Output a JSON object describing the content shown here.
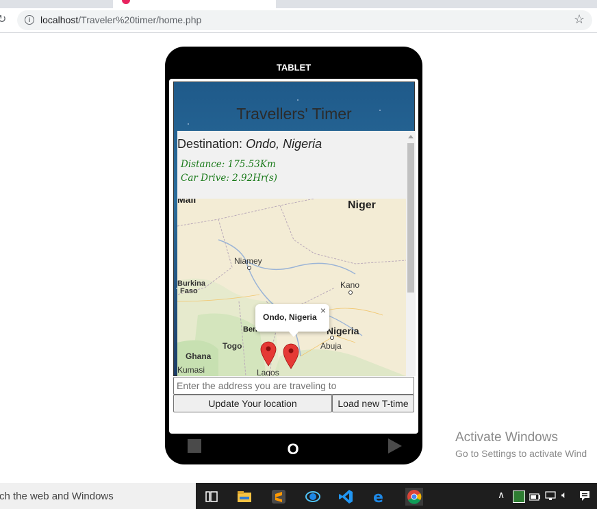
{
  "browser": {
    "url_host": "localhost",
    "url_path": "/Traveler%20timer/home.php",
    "info_icon": "info-icon",
    "star_icon": "bookmark-star-icon",
    "reload_icon": "reload-icon",
    "tab_favicon_color": "#e8235f"
  },
  "tablet": {
    "label": "TABLET",
    "app_title": "Travellers' Timer",
    "destination_prefix": "Destination: ",
    "destination_value": "Ondo, Nigeria",
    "distance_text": "Distance: 175.53Km",
    "drive_text": "Car Drive: 2.92Hr(s)",
    "address_placeholder": "Enter the address you are traveling to",
    "update_button": "Update Your location",
    "load_button": "Load new T-time",
    "nav_home": "O",
    "colors": {
      "info_text": "#1a7a1a",
      "frame": "#000000"
    }
  },
  "map": {
    "labels": {
      "mali": "Mali",
      "niger": "Niger",
      "niamey": "Niamey",
      "burkina": "Burkina",
      "faso": "Faso",
      "kano": "Kano",
      "benin": "Ben",
      "nigeria": "Nigeria",
      "abuja": "Abuja",
      "togo": "Togo",
      "ghana": "Ghana",
      "kumasi": "Kumasi",
      "lagos": "Lagos"
    },
    "popup_text": "Ondo, Nigeria",
    "popup_close": "×",
    "marker_color": "#e53935"
  },
  "watermark": {
    "line1": "Activate Windows",
    "line2": "Go to Settings to activate Wind"
  },
  "taskbar": {
    "search_text": "rch the web and Windows",
    "icons": [
      "task-view-icon",
      "file-explorer-icon",
      "sublime-text-icon",
      "edge-legacy-icon",
      "vscode-icon",
      "edge-icon",
      "chrome-icon"
    ],
    "tray": [
      "chevron-up-icon",
      "whatsapp-icon",
      "battery-icon",
      "network-icon",
      "volume-icon",
      "notification-icon"
    ]
  }
}
